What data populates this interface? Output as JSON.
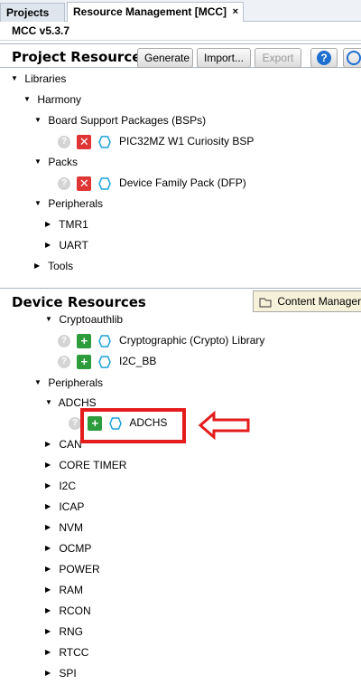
{
  "tabs": [
    {
      "label": "Projects",
      "active": false
    },
    {
      "label": "Resource Management [MCC]",
      "active": true,
      "close": "×"
    }
  ],
  "version": "MCC v5.3.7",
  "project_resources": {
    "title": "Project Resources",
    "buttons": {
      "generate": "Generate",
      "import": "Import...",
      "export": "Export"
    },
    "tree": [
      {
        "label": "Libraries"
      },
      {
        "label": "Harmony"
      },
      {
        "label": "Board Support Packages (BSPs)"
      },
      {
        "label": "PIC32MZ W1 Curiosity BSP"
      },
      {
        "label": "Packs"
      },
      {
        "label": "Device Family Pack (DFP)"
      },
      {
        "label": "Peripherals"
      },
      {
        "label": "TMR1"
      },
      {
        "label": "UART"
      },
      {
        "label": "Tools"
      }
    ]
  },
  "device_resources": {
    "title": "Device Resources",
    "content_manager_tab": "Content Manager",
    "tree": [
      {
        "label": "Cryptoauthlib"
      },
      {
        "label": "Cryptographic (Crypto) Library"
      },
      {
        "label": "I2C_BB"
      },
      {
        "label": "Peripherals"
      },
      {
        "label": "ADCHS"
      },
      {
        "label": "ADCHS"
      },
      {
        "label": "CAN"
      },
      {
        "label": "CORE TIMER"
      },
      {
        "label": "I2C"
      },
      {
        "label": "ICAP"
      },
      {
        "label": "NVM"
      },
      {
        "label": "OCMP"
      },
      {
        "label": "POWER"
      },
      {
        "label": "RAM"
      },
      {
        "label": "RCON"
      },
      {
        "label": "RNG"
      },
      {
        "label": "RTCC"
      },
      {
        "label": "SPI"
      }
    ]
  },
  "icons": {
    "help": "?",
    "remove": "✕",
    "add": "+",
    "expanded": "▼",
    "collapsed": "▶"
  },
  "colors": {
    "highlight": "#e41c1c",
    "add": "#2e9c3d",
    "remove": "#e03535",
    "accent": "#1e6fd0"
  }
}
